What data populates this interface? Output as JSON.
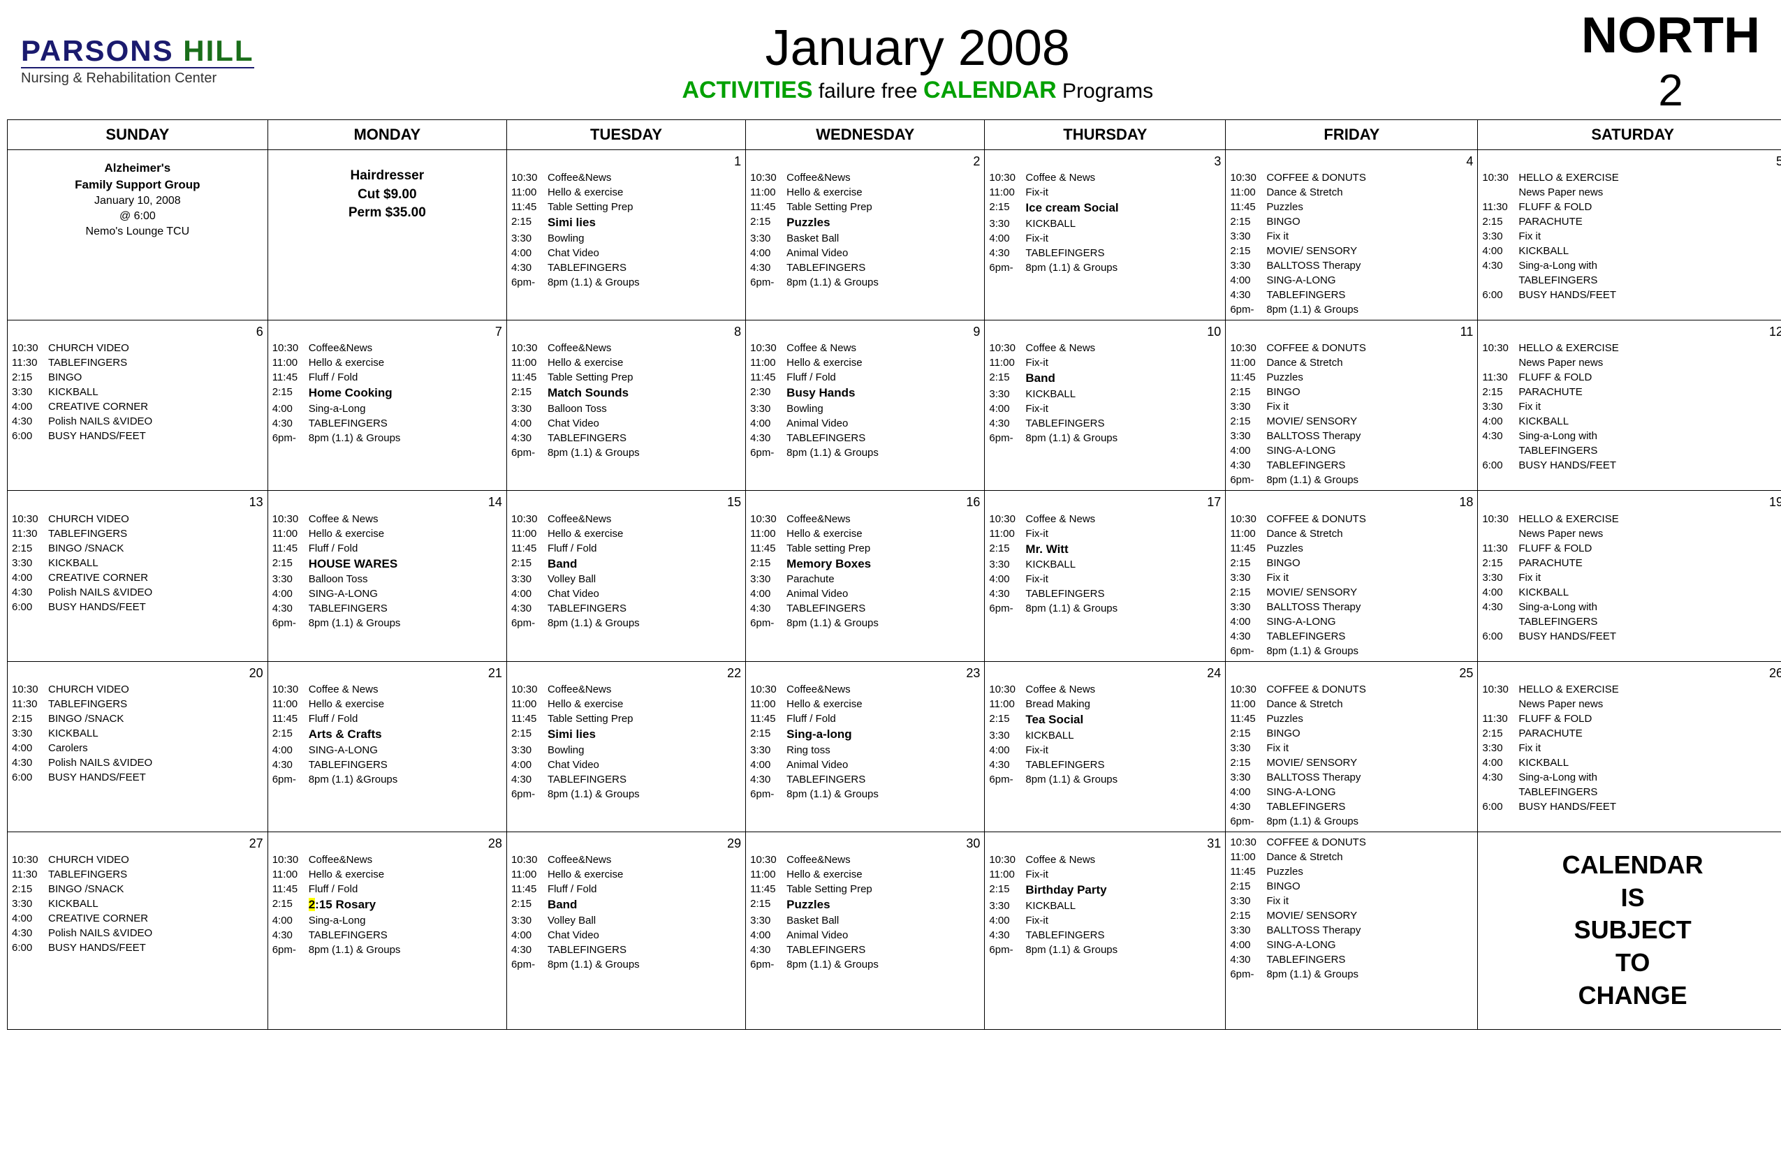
{
  "header": {
    "logo_top": "PARSONS HILL",
    "logo_parsons": "PARSONS ",
    "logo_hill": "HILL",
    "logo_subtitle": "Nursing & Rehabilitation Center",
    "month": "January 2008",
    "activities_prefix": "ACTIVITIES",
    "activities_middle": " failure free ",
    "activities_calendar": "CALENDAR",
    "activities_suffix": " Programs",
    "north": "NORTH",
    "north_num": "2"
  },
  "days_of_week": [
    "SUNDAY",
    "MONDAY",
    "TUESDAY",
    "WEDNESDAY",
    "THURSDAY",
    "FRIDAY",
    "SATURDAY"
  ],
  "notice_change": "CALENDAR IS SUBJECT TO CHANGE"
}
